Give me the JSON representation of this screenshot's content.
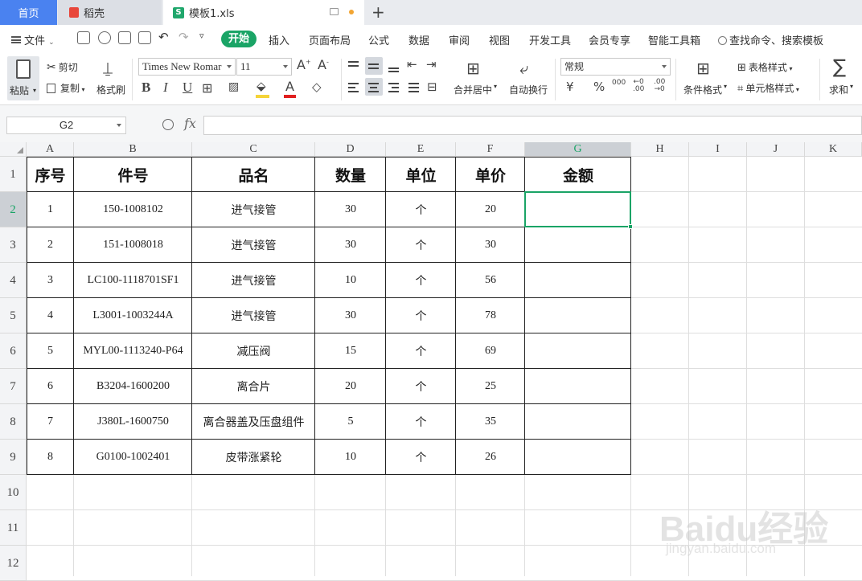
{
  "tabs": {
    "home": "首页",
    "daoke": "稻壳",
    "file": "模板1.xls",
    "file_icon": "S",
    "add": "+"
  },
  "menu": {
    "file": "文件",
    "start": "开始",
    "items": [
      "插入",
      "页面布局",
      "公式",
      "数据",
      "审阅",
      "视图",
      "开发工具",
      "会员专享",
      "智能工具箱"
    ],
    "search": "查找命令、搜索模板"
  },
  "ribbon": {
    "paste": "粘贴",
    "cut": "剪切",
    "copy": "复制",
    "format_painter": "格式刷",
    "font_name": "Times New Romar",
    "font_size": "11",
    "bold": "B",
    "italic": "I",
    "underline": "U",
    "number_format": "常规",
    "merge_center": "合并居中",
    "wrap_text": "自动换行",
    "currency": "¥",
    "percent": "%",
    "thousands": "000",
    "cond_format": "条件格式",
    "table_style": "表格样式",
    "cell_style": "单元格样式",
    "sum": "求和",
    "sigma": "∑"
  },
  "formula_bar": {
    "name_box": "G2",
    "fx": "fx",
    "content": ""
  },
  "sheet": {
    "columns": [
      "A",
      "B",
      "C",
      "D",
      "E",
      "F",
      "G",
      "H",
      "I",
      "J",
      "K"
    ],
    "rows": [
      "1",
      "2",
      "3",
      "4",
      "5",
      "6",
      "7",
      "8",
      "9",
      "10",
      "11",
      "12"
    ],
    "active_cell": "G2",
    "headers": [
      "序号",
      "件号",
      "品名",
      "数量",
      "单位",
      "单价",
      "金额"
    ],
    "data": [
      [
        "1",
        "150-1008102",
        "进气接管",
        "30",
        "个",
        "20",
        ""
      ],
      [
        "2",
        "151-1008018",
        "进气接管",
        "30",
        "个",
        "30",
        ""
      ],
      [
        "3",
        "LC100-1118701SF1",
        "进气接管",
        "10",
        "个",
        "56",
        ""
      ],
      [
        "4",
        "L3001-1003244A",
        "进气接管",
        "30",
        "个",
        "78",
        ""
      ],
      [
        "5",
        "MYL00-1113240-P64",
        "减压阀",
        "15",
        "个",
        "69",
        ""
      ],
      [
        "6",
        "B3204-1600200",
        "离合片",
        "20",
        "个",
        "25",
        ""
      ],
      [
        "7",
        "J380L-1600750",
        "离合器盖及压盘组件",
        "5",
        "个",
        "35",
        ""
      ],
      [
        "8",
        "G0100-1002401",
        "皮带涨紧轮",
        "10",
        "个",
        "26",
        ""
      ]
    ]
  },
  "watermark": {
    "brand": "Baidu经验",
    "url": "jingyan.baidu.com"
  },
  "colors": {
    "accent_green": "#1aa466",
    "home_tab_blue": "#4a82f0"
  }
}
